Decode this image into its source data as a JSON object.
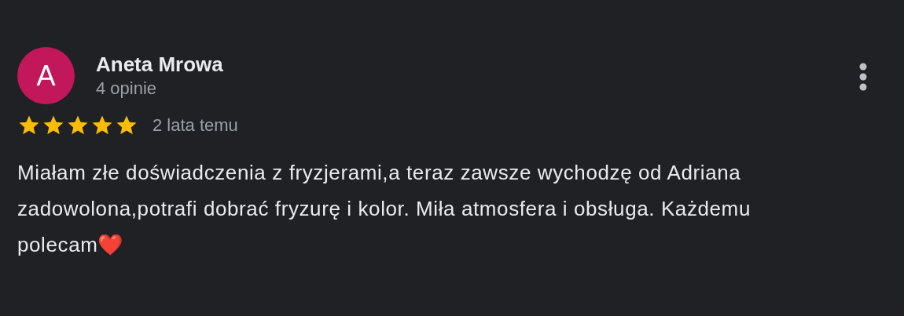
{
  "review": {
    "avatar_letter": "A",
    "author": "Aneta Mrowa",
    "review_count": "4 opinie",
    "stars": 5,
    "time": "2 lata temu",
    "text": "Miałam złe doświadczenia z fryzjerami,a teraz zawsze wychodzę od Adriana zadowolona,potrafi dobrać fryzurę i kolor. Miła atmosfera i obsługa. Każdemu polecam❤️"
  }
}
